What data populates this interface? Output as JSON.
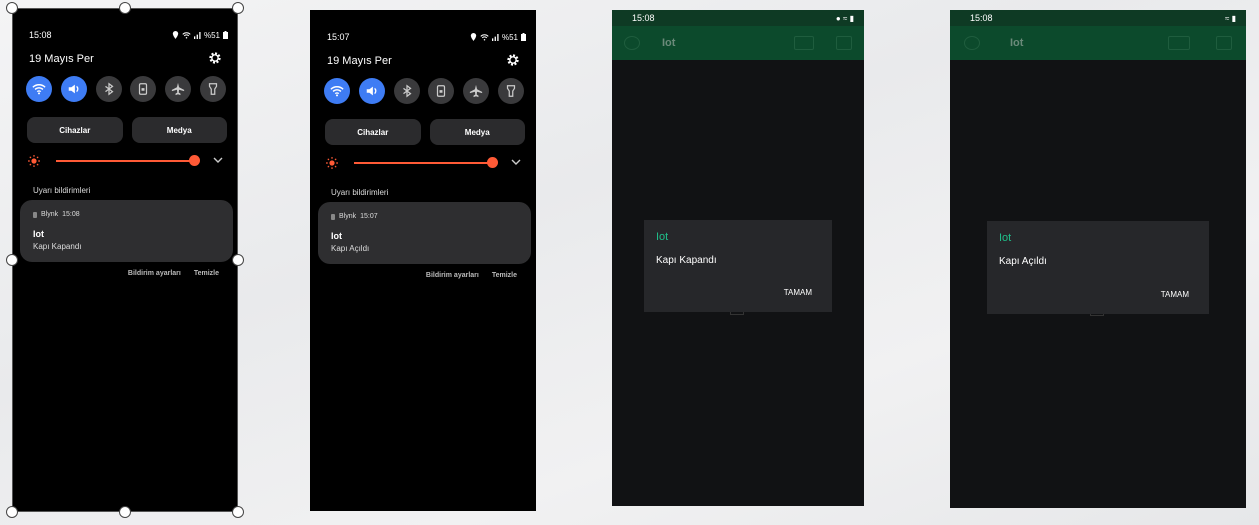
{
  "colors": {
    "accent_blue": "#3e7cf4",
    "slider_orange": "#ff5a36",
    "app_bar_green": "#0c4a2c",
    "dialog_title_green": "#1fbf8a"
  },
  "panel1": {
    "time": "15:08",
    "battery": "%51",
    "date": "19 Mayıs Per",
    "toggles": [
      "wifi-icon",
      "sound-icon",
      "bluetooth-icon",
      "lock-rotation-icon",
      "airplane-icon",
      "flashlight-icon"
    ],
    "devices_label": "Cihazlar",
    "media_label": "Medya",
    "brightness_level": 0.93,
    "section_label": "Uyarı bildirimleri",
    "notification": {
      "app": "Blynk",
      "time": "15:08",
      "title": "Iot",
      "body": "Kapı Kapandı"
    },
    "settings_label": "Bildirim ayarları",
    "clear_label": "Temizle"
  },
  "panel2": {
    "time": "15:07",
    "battery": "%51",
    "date": "19 Mayıs Per",
    "devices_label": "Cihazlar",
    "media_label": "Medya",
    "brightness_level": 0.93,
    "section_label": "Uyarı bildirimleri",
    "notification": {
      "app": "Blynk",
      "time": "15:07",
      "title": "Iot",
      "body": "Kapı Açıldı"
    },
    "settings_label": "Bildirim ayarları",
    "clear_label": "Temizle"
  },
  "app1": {
    "time": "15:08",
    "title": "Iot",
    "dialog": {
      "title": "Iot",
      "message": "Kapı Kapandı",
      "ok": "TAMAM"
    }
  },
  "app2": {
    "time": "15:08",
    "title": "Iot",
    "dialog": {
      "title": "Iot",
      "message": "Kapı Açıldı",
      "ok": "TAMAM"
    }
  }
}
